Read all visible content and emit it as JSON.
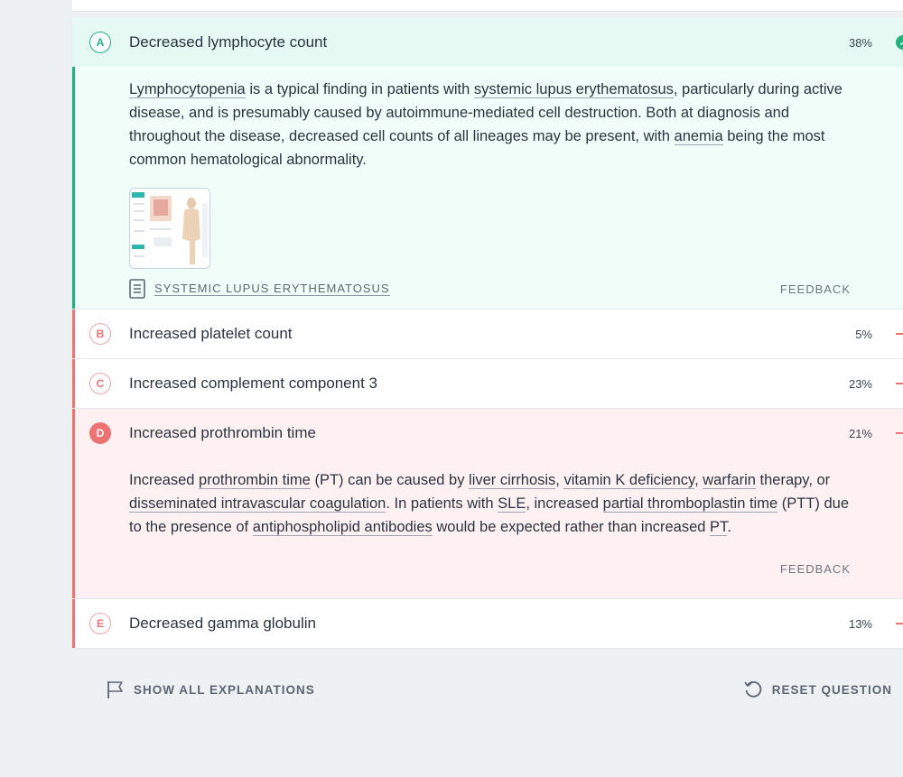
{
  "options": [
    {
      "letter": "A",
      "text": "Decreased lymphocyte count",
      "percent": "38%",
      "status": "correct",
      "explanation": {
        "parts": [
          "Lymphocytopenia",
          " is a typical finding in patients with ",
          "systemic lupus erythematosus",
          ", particularly during active disease, and is presumably caused by autoimmune-mediated cell destruction. Both at diagnosis and throughout the disease, decreased cell counts of all lineages may be present, with ",
          "anemia",
          " being the most common hematological abnormality."
        ]
      },
      "article_link": "SYSTEMIC LUPUS ERYTHEMATOSUS",
      "feedback": "FEEDBACK"
    },
    {
      "letter": "B",
      "text": "Increased platelet count",
      "percent": "5%",
      "status": "wrong"
    },
    {
      "letter": "C",
      "text": "Increased complement component 3",
      "percent": "23%",
      "status": "wrong"
    },
    {
      "letter": "D",
      "text": "Increased prothrombin time",
      "percent": "21%",
      "status": "selected-wrong",
      "explanation": {
        "parts": [
          "Increased ",
          "prothrombin time",
          " (PT) can be caused by ",
          "liver cirrhosis",
          ", ",
          "vitamin K deficiency",
          ", ",
          "warfarin",
          " therapy, or ",
          "disseminated intravascular coagulation",
          ". In patients with ",
          "SLE",
          ", increased ",
          "partial thromboplastin time",
          " (PTT) due to the presence of ",
          "antiphospholipid antibodies",
          " would be expected rather than increased ",
          "PT",
          "."
        ]
      },
      "feedback": "FEEDBACK"
    },
    {
      "letter": "E",
      "text": "Decreased gamma globulin",
      "percent": "13%",
      "status": "wrong"
    }
  ],
  "bottom": {
    "show_all": "SHOW ALL EXPLANATIONS",
    "reset": "RESET QUESTION"
  },
  "icons": {
    "correct": "check-circle-icon",
    "wrong": "dash-icon",
    "article": "document-icon",
    "show_all": "flag-icon",
    "reset": "undo-icon"
  },
  "colors": {
    "correct_accent": "#22b07d",
    "wrong_accent": "#ef7272",
    "correct_bg": "#e6faf3",
    "wrong_bg": "#fff1f2"
  }
}
